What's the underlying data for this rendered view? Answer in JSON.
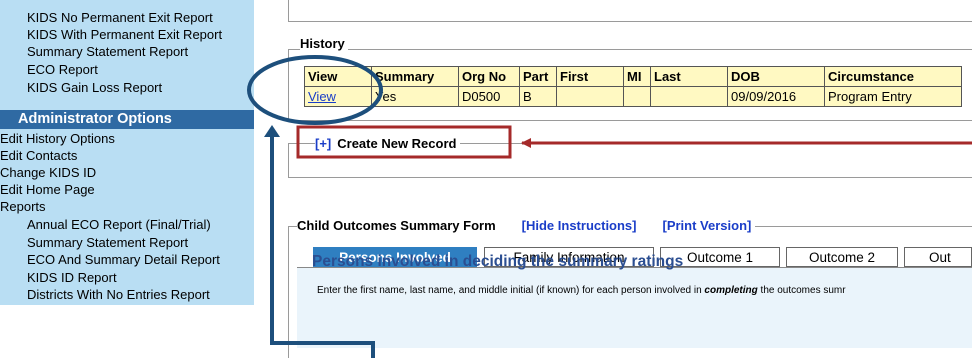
{
  "sidebar": {
    "reports_top": [
      "KIDS No Permanent Exit Report",
      "KIDS With Permanent Exit Report",
      "Summary Statement Report",
      "ECO Report",
      "KIDS Gain Loss Report"
    ],
    "admin_header": "Administrator Options",
    "admin_items": [
      "Edit History Options",
      "Edit Contacts",
      "Change KIDS ID",
      "Edit Home Page",
      "Reports"
    ],
    "report_items": [
      "Annual ECO Report (Final/Trial)",
      "Summary Statement Report",
      "ECO And Summary Detail Report",
      "KIDS ID Report",
      "Districts With No Entries Report"
    ]
  },
  "history": {
    "legend": "History",
    "columns": [
      "View",
      "Summary",
      "Org No",
      "Part",
      "First",
      "MI",
      "Last",
      "DOB",
      "Circumstance"
    ],
    "row": [
      "View",
      "Yes",
      "D0500",
      "B",
      "",
      "",
      "",
      "09/09/2016",
      "Program Entry"
    ]
  },
  "create_record": {
    "plus": "[+]",
    "label": "Create New Record"
  },
  "cos": {
    "title": "Child Outcomes Summary Form",
    "hide_link": "[Hide Instructions]",
    "print_link": "[Print Version]"
  },
  "tabs": [
    "Persons Involved",
    "Family Information",
    "Outcome 1",
    "Outcome 2",
    "Out"
  ],
  "section": {
    "heading": "Persons involved in deciding the summary ratings",
    "instr_a": "Enter the first name, last name, and middle initial (if known) for each person involved in ",
    "instr_em": "completing",
    "instr_b": " the outcomes sumr"
  },
  "colors": {
    "sidebar_bg": "#b9def3",
    "admin_header_bg": "#2f6aa3",
    "row_highlight": "#fff9c2",
    "link_blue": "#1a3dc8",
    "annotation_red": "#a52a2a",
    "annotation_navy": "#1d4f7c"
  }
}
